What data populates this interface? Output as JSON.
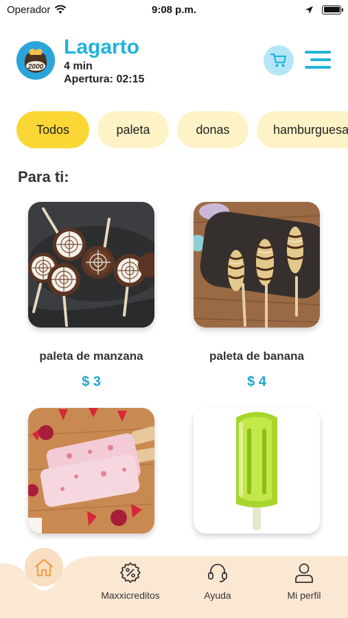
{
  "status_bar": {
    "carrier": "Operador",
    "time": "9:08 p.m."
  },
  "store": {
    "name": "Lagarto",
    "wait_time": "4 min",
    "opening": "Apertura: 02:15",
    "logo_text": "2000"
  },
  "categories": [
    {
      "label": "Todos",
      "active": true
    },
    {
      "label": "paleta",
      "active": false
    },
    {
      "label": "donas",
      "active": false
    },
    {
      "label": "hamburguesas",
      "active": false
    }
  ],
  "section_title": "Para ti:",
  "products": [
    {
      "name": "paleta de manzana",
      "price": "$ 3",
      "image": "chocolate-spiderweb-pops"
    },
    {
      "name": "paleta de banana",
      "price": "$ 4",
      "image": "chocolate-banana-pops"
    },
    {
      "name": "",
      "price": "",
      "image": "strawberry-popsicles"
    },
    {
      "name": "",
      "price": "",
      "image": "lime-popsicle"
    }
  ],
  "bottom_nav": {
    "home": "home-icon",
    "items": [
      {
        "label": "Maxxicreditos",
        "icon": "discount-icon"
      },
      {
        "label": "Ayuda",
        "icon": "headset-icon"
      },
      {
        "label": "Mi perfil",
        "icon": "user-icon"
      }
    ]
  },
  "colors": {
    "accent_blue": "#1fb3d9",
    "chip_active": "#fbd736",
    "chip_inactive": "#fdf3c6",
    "price_blue": "#1fa5d0",
    "nav_background": "#fbe8d3"
  }
}
